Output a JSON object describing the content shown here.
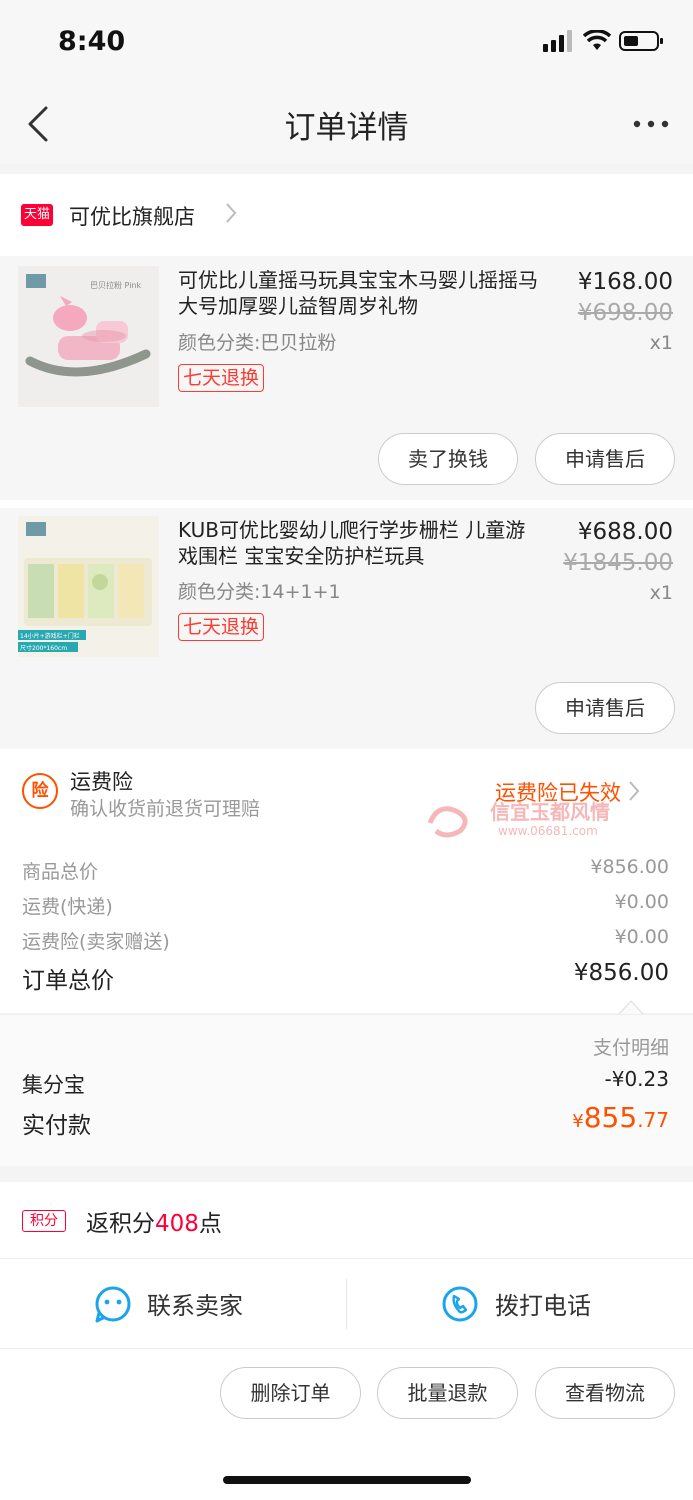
{
  "status_bar": {
    "time": "8:40",
    "icons": [
      "signal-icon",
      "wifi-icon",
      "battery-icon"
    ]
  },
  "nav": {
    "title": "订单详情",
    "back_icon": "chevron-left-icon",
    "more_icon": "more-icon"
  },
  "shop": {
    "badge": "天猫",
    "name": "可优比旗舰店"
  },
  "items": [
    {
      "title": "可优比儿童摇马玩具宝宝木马婴儿摇摇马大号加厚婴儿益智周岁礼物",
      "sku": "颜色分类:巴贝拉粉",
      "tag": "七天退换",
      "price": "¥168.00",
      "original_price": "¥698.00",
      "qty": "x1",
      "thumb_text": "巴贝拉粉  Pink",
      "buttons": [
        "卖了换钱",
        "申请售后"
      ]
    },
    {
      "title": "KUB可优比婴幼儿爬行学步栅栏 儿童游戏围栏 宝宝安全防护栏玩具",
      "sku": "颜色分类:14+1+1",
      "tag": "七天退换",
      "price": "¥688.00",
      "original_price": "¥1845.00",
      "qty": "x1",
      "thumb_text": "14小片+游戏栏+门栏",
      "thumb_text2": "尺寸200*160cm",
      "buttons": [
        "申请售后"
      ]
    }
  ],
  "insurance": {
    "icon_text": "险",
    "title": "运费险",
    "desc": "确认收货前退货可理赔",
    "status": "运费险已失效"
  },
  "watermark": {
    "title": "信宜玉都风情",
    "url": "www.06681.com"
  },
  "summary": {
    "rows": [
      {
        "label": "商品总价",
        "value": "¥856.00"
      },
      {
        "label": "运费(快递)",
        "value": "¥0.00"
      },
      {
        "label": "运费险(卖家赠送)",
        "value": "¥0.00"
      }
    ],
    "total_label": "订单总价",
    "total_value": "¥856.00"
  },
  "payment": {
    "detail_label": "支付明细",
    "jifenbao_label": "集分宝",
    "jifenbao_value": "-¥0.23",
    "paid_label": "实付款",
    "paid_currency": "¥",
    "paid_integer": "855",
    "paid_decimal": ".77"
  },
  "points": {
    "badge": "积分",
    "prefix": "返积分",
    "number": "408",
    "suffix": "点"
  },
  "contact": {
    "seller_label": "联系卖家",
    "phone_label": "拨打电话"
  },
  "actions": [
    "删除订单",
    "批量退款",
    "查看物流"
  ],
  "colors": {
    "accent": "#ff5000",
    "tmall_red": "#ff0036",
    "tag_red": "#ff3b30"
  }
}
